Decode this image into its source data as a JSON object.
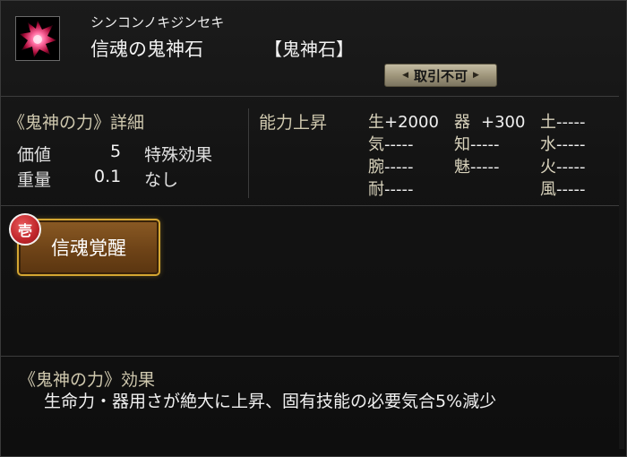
{
  "item": {
    "reading": "シンコンノキジンセキ",
    "name": "信魂の鬼神石",
    "category": "【鬼神石】",
    "trade_status": "取引不可"
  },
  "details": {
    "header": "《鬼神の力》詳細",
    "value_label": "価値",
    "value": "5",
    "weight_label": "重量",
    "weight": "0.1",
    "special_label": "特殊効果",
    "special_value": "なし"
  },
  "abilities": {
    "header": "能力上昇",
    "col1": [
      {
        "k": "生",
        "v": "+2000"
      },
      {
        "k": "気",
        "v": "-----"
      },
      {
        "k": "腕",
        "v": "-----"
      },
      {
        "k": "耐",
        "v": "-----"
      }
    ],
    "col2": [
      {
        "k": "器",
        "v": "+300"
      },
      {
        "k": "知",
        "v": "-----"
      },
      {
        "k": "魅",
        "v": "-----"
      }
    ],
    "col3": [
      {
        "k": "土",
        "v": "-----"
      },
      {
        "k": "水",
        "v": "-----"
      },
      {
        "k": "火",
        "v": "-----"
      },
      {
        "k": "風",
        "v": "-----"
      }
    ]
  },
  "awakening": {
    "seal": "壱",
    "button": "信魂覚醒"
  },
  "effect": {
    "header": "《鬼神の力》効果",
    "text": "生命力・器用さが絶大に上昇、固有技能の必要気合5%減少"
  },
  "colors": {
    "accent_gold": "#d4a632",
    "seal_red": "#c0262b",
    "gem_crimson": "#e0305a"
  }
}
